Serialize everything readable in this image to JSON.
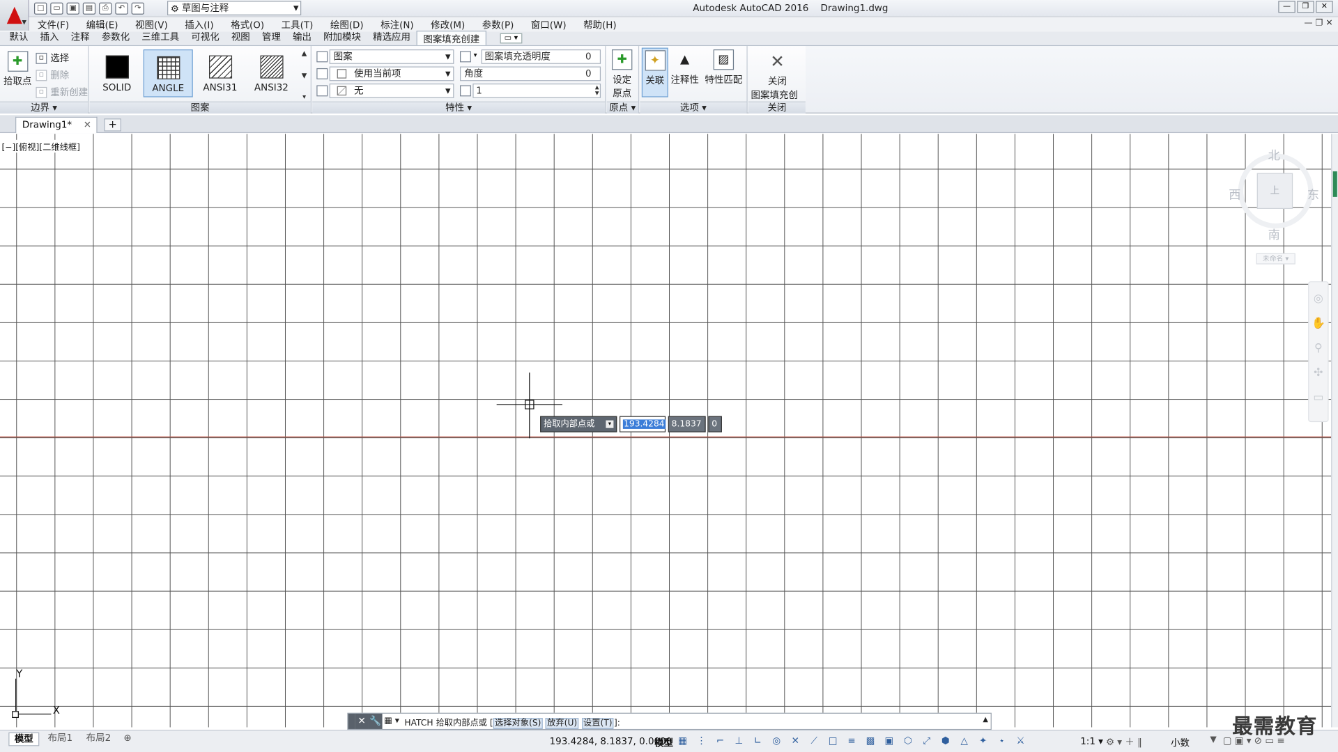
{
  "title": {
    "app": "Autodesk AutoCAD 2016",
    "file": "Drawing1.dwg"
  },
  "workspace": "草图与注释",
  "menu": [
    "文件(F)",
    "编辑(E)",
    "视图(V)",
    "插入(I)",
    "格式(O)",
    "工具(T)",
    "绘图(D)",
    "标注(N)",
    "修改(M)",
    "参数(P)",
    "窗口(W)",
    "帮助(H)"
  ],
  "ribbon_tabs": [
    "默认",
    "插入",
    "注释",
    "参数化",
    "三维工具",
    "可视化",
    "视图",
    "管理",
    "输出",
    "附加模块",
    "精选应用",
    "图案填充创建"
  ],
  "ribbon_active_tab": "图案填充创建",
  "boundary": {
    "pick": "拾取点",
    "select": "选择",
    "remove": "删除",
    "recreate": "重新创建",
    "footer": "边界 ▾"
  },
  "patterns": {
    "items": [
      "SOLID",
      "ANGLE",
      "ANSI31",
      "ANSI32"
    ],
    "selected": "ANGLE",
    "footer": "图案"
  },
  "properties": {
    "type": "图案",
    "color": "使用当前项",
    "bg": "无",
    "transparency_label": "图案填充透明度",
    "transparency_value": "0",
    "angle_label": "角度",
    "angle_value": "0",
    "scale_value": "1",
    "footer": "特性 ▾"
  },
  "origin": {
    "set": "设定",
    "set2": "原点",
    "footer": "原点 ▾"
  },
  "options": {
    "assoc": "关联",
    "annot": "注释性",
    "match": "特性匹配",
    "footer": "选项 ▾"
  },
  "close": {
    "label": "关闭",
    "label2": "图案填充创建",
    "footer": "关闭"
  },
  "doc_tab": "Drawing1*",
  "viewport_label": "[−][俯视][二维线框]",
  "viewcube": {
    "north": "北",
    "south": "南",
    "east": "东",
    "west": "西",
    "face": "上",
    "wcs": "未命名 ▾"
  },
  "ucs": {
    "x": "X",
    "y": "Y"
  },
  "dynamic_input": {
    "prompt": "拾取内部点或",
    "x": "193.4284",
    "y": "8.1837",
    "z": "0"
  },
  "command_line": {
    "cmd": "HATCH 拾取内部点或 [",
    "opt1": "选择对象(S)",
    "opt2": "放弃(U)",
    "opt3": "设置(T)",
    "tail": "]:"
  },
  "layout_tabs": [
    "模型",
    "布局1",
    "布局2"
  ],
  "status": {
    "coords": "193.4284, 8.1837, 0.0000",
    "model": "模型",
    "scale": "1:1 ▾",
    "units": "小数"
  },
  "watermark": "最需教育",
  "colors": {
    "accent": "#3b7dd8",
    "axis_red": "#b54a3a",
    "logo_red": "#d01010"
  }
}
